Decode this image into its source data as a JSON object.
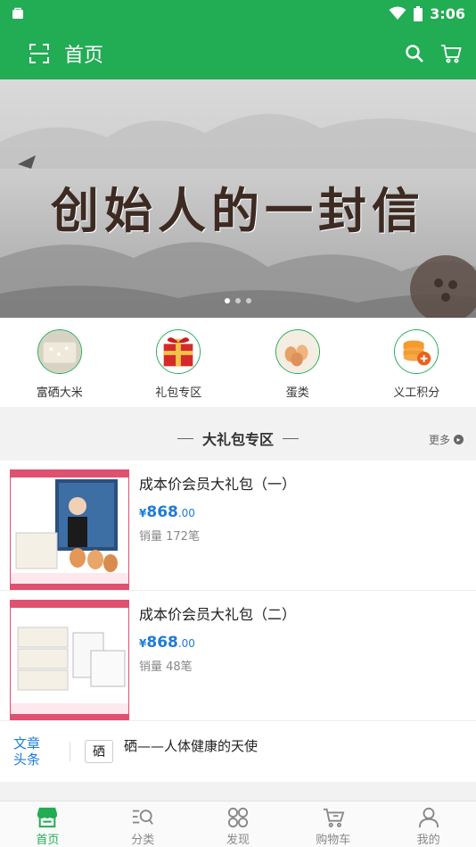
{
  "status_bar": {
    "time": "3:06",
    "icons": [
      "notification-icon",
      "wifi-icon",
      "battery-icon"
    ]
  },
  "app_bar": {
    "title": "首页",
    "scan_icon": "scan-icon",
    "search_icon": "search-icon",
    "cart_icon": "cart-icon"
  },
  "banner": {
    "text": "创始人的一封信",
    "slide_count": 3,
    "active_slide": 1
  },
  "categories": [
    {
      "label": "富硒大米",
      "icon": "rice-icon"
    },
    {
      "label": "礼包专区",
      "icon": "gift-icon"
    },
    {
      "label": "蛋类",
      "icon": "egg-icon"
    },
    {
      "label": "义工积分",
      "icon": "points-icon"
    }
  ],
  "section": {
    "title": "大礼包专区",
    "more": "更多"
  },
  "products": [
    {
      "name": "成本价会员大礼包（一）",
      "currency": "¥",
      "price_int": "868",
      "price_dec": ".00",
      "sales": "销量 172笔"
    },
    {
      "name": "成本价会员大礼包（二）",
      "currency": "¥",
      "price_int": "868",
      "price_dec": ".00",
      "sales": "销量 48笔"
    }
  ],
  "news": {
    "tag_line1": "文章",
    "tag_line2": "头条",
    "logo_text": "硒",
    "headline": "硒——人体健康的天使"
  },
  "bottom_nav": [
    {
      "label": "首页",
      "icon": "home-store-icon",
      "active": true
    },
    {
      "label": "分类",
      "icon": "category-search-icon",
      "active": false
    },
    {
      "label": "发现",
      "icon": "discover-grid-icon",
      "active": false
    },
    {
      "label": "购物车",
      "icon": "cart-icon",
      "active": false
    },
    {
      "label": "我的",
      "icon": "profile-icon",
      "active": false
    }
  ],
  "colors": {
    "brand_green": "#22ac54",
    "price_blue": "#1f7bd8"
  }
}
